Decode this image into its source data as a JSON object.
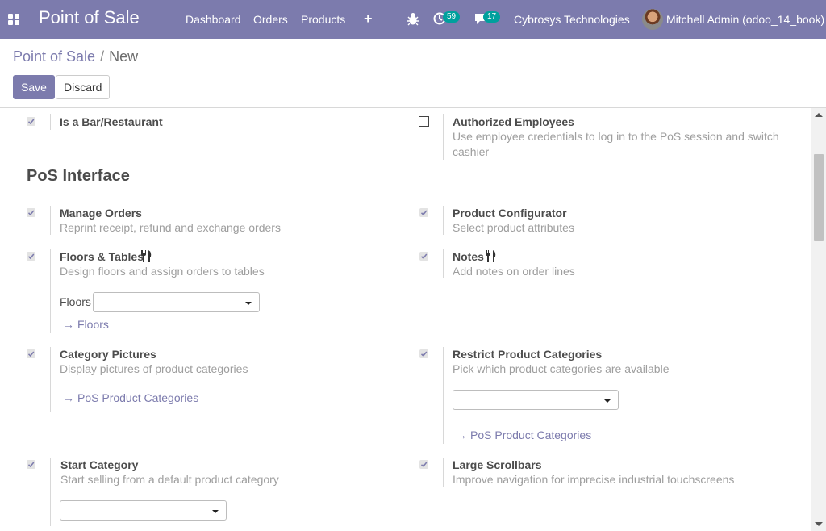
{
  "navbar": {
    "brand": "Point of Sale",
    "menus": [
      "Dashboard",
      "Orders",
      "Products"
    ],
    "activity_count": "59",
    "message_count": "17",
    "company": "Cybrosys Technologies",
    "user": "Mitchell Admin (odoo_14_book)",
    "icons": [
      "apps-icon",
      "plus-icon",
      "bug-icon",
      "activity-icon",
      "chat-icon",
      "avatar"
    ]
  },
  "breadcrumb": {
    "parent": "Point of Sale",
    "separator": "/",
    "current": "New"
  },
  "buttons": {
    "save": "Save",
    "discard": "Discard"
  },
  "colors": {
    "brand": "#7c7bad",
    "badge": "#00a09d",
    "muted": "#9e9e9e"
  },
  "settings": {
    "bar_restaurant": {
      "label": "Is a Bar/Restaurant",
      "checked": true
    },
    "authorized_employees": {
      "label": "Authorized Employees",
      "desc_line1": "Use employee credentials to log in to the PoS session and switch",
      "desc_line2": "cashier",
      "checked": false
    },
    "section_title": "PoS Interface",
    "manage_orders": {
      "label": "Manage Orders",
      "desc": "Reprint receipt, refund and exchange orders",
      "checked": true
    },
    "product_configurator": {
      "label": "Product Configurator",
      "desc": "Select product attributes",
      "checked": true
    },
    "floors_tables": {
      "label": "Floors & Tables",
      "desc": "Design floors and assign orders to tables",
      "checked": true,
      "field_label": "Floors",
      "field_value": "",
      "link": "Floors"
    },
    "notes": {
      "label": "Notes",
      "desc": "Add notes on order lines",
      "checked": true
    },
    "category_pictures": {
      "label": "Category Pictures",
      "desc": "Display pictures of product categories",
      "checked": true,
      "link": "PoS Product Categories"
    },
    "restrict_categories": {
      "label": "Restrict Product Categories",
      "desc": "Pick which product categories are available",
      "checked": true,
      "field_value": "",
      "link": "PoS Product Categories"
    },
    "start_category": {
      "label": "Start Category",
      "desc": "Start selling from a default product category",
      "checked": true,
      "field_value": ""
    },
    "large_scrollbars": {
      "label": "Large Scrollbars",
      "desc": "Improve navigation for imprecise industrial touchscreens",
      "checked": true
    }
  }
}
